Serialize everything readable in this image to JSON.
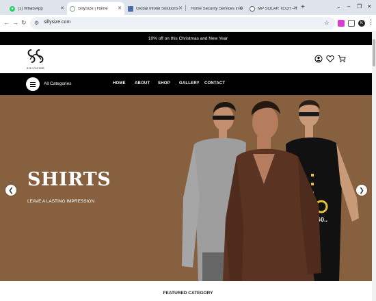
{
  "browser": {
    "tabs": [
      {
        "title": "(1) WhatsApp",
        "favicon": "whatsapp-icon",
        "color": "#25D366"
      },
      {
        "title": "SillySize | Home",
        "favicon": "site-icon",
        "color": "#333333",
        "active": true
      },
      {
        "title": "Global Infotel Solutions",
        "favicon": "page-icon",
        "color": "#4a6fa5"
      },
      {
        "title": "Home Security Services in Delhi",
        "favicon": "",
        "color": "#999999"
      },
      {
        "title": "MP SOLAR TECH – Home",
        "favicon": "globe-icon",
        "color": "#666666"
      }
    ],
    "new_tab": "+",
    "window_controls": [
      "⌄",
      "–",
      "❐",
      "✕"
    ],
    "url": "sillysize.com",
    "extension_avatar": "K"
  },
  "site": {
    "promo": "10% off on this Christmas and New Year",
    "brand": "SILLYSIZE",
    "categories_label": "All Categories",
    "menu": [
      "HOME",
      "ABOUT",
      "SHOP",
      "GALLERY",
      "CONTACT"
    ],
    "hero": {
      "title": "SHIRTS",
      "subtitle": "LEAVE A LASTING IMPRESSION",
      "bg_color": "#86603f",
      "tee_print": "G0.."
    },
    "featured_title": "FEATURED CATEGORY"
  }
}
